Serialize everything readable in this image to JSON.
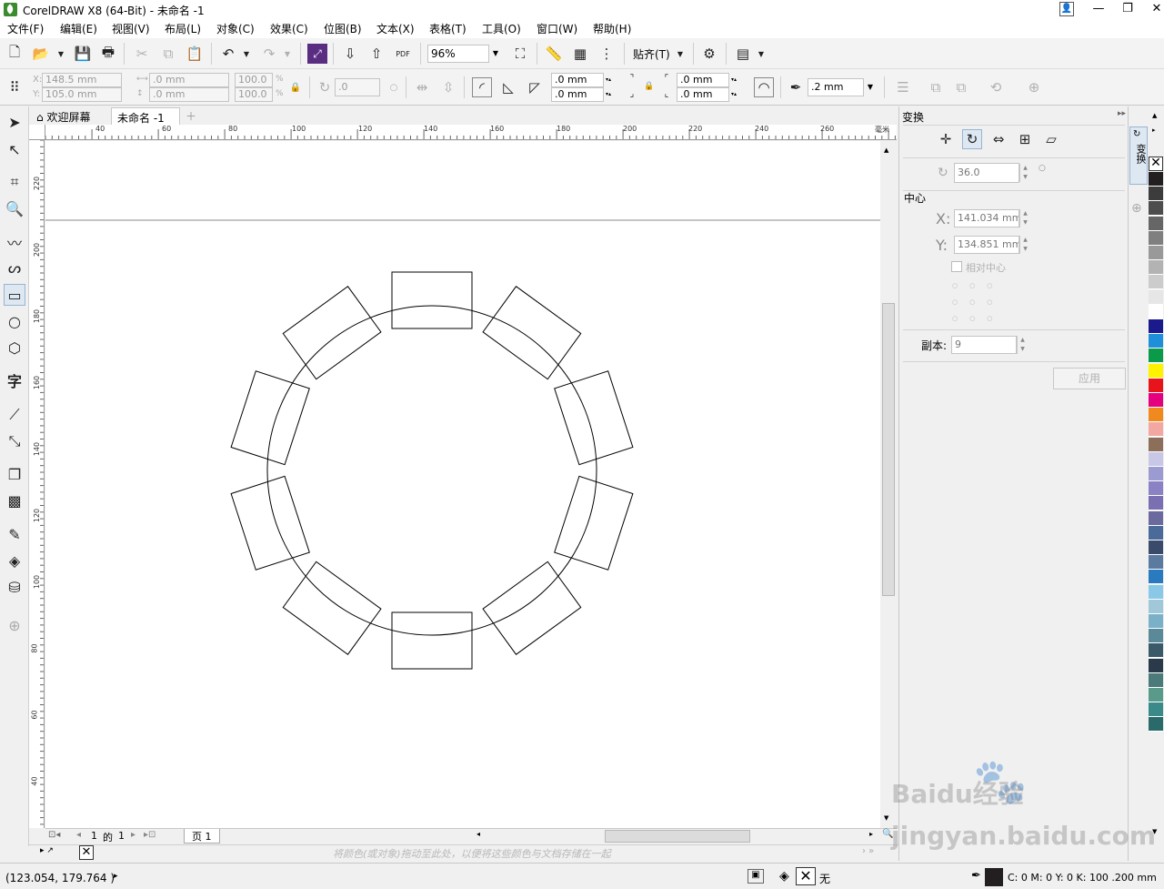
{
  "window": {
    "title": "CorelDRAW X8 (64-Bit) - 未命名 -1"
  },
  "menu": [
    "文件(F)",
    "编辑(E)",
    "视图(V)",
    "布局(L)",
    "对象(C)",
    "效果(C)",
    "位图(B)",
    "文本(X)",
    "表格(T)",
    "工具(O)",
    "窗口(W)",
    "帮助(H)"
  ],
  "toolbar": {
    "zoom_value": "96%",
    "snap_label": "贴齐(T)",
    "pdf_label": "PDF"
  },
  "property_bar": {
    "x": "148.5 mm",
    "y": "105.0 mm",
    "width": ".0 mm",
    "height": ".0 mm",
    "scale_x": "100.0",
    "scale_y": "100.0",
    "percent": "%",
    "rotation": ".0",
    "corner_1": ".0 mm",
    "corner_2": ".0 mm",
    "corner_3": ".0 mm",
    "corner_4": ".0 mm",
    "outline_width": ".2 mm"
  },
  "doc_tabs": {
    "welcome": "欢迎屏幕",
    "document": "未命名 -1"
  },
  "rulers": {
    "h_ticks": [
      "40",
      "60",
      "80",
      "100",
      "120",
      "140",
      "160",
      "180",
      "200",
      "220",
      "240",
      "260"
    ],
    "h_unit": "毫米",
    "v_ticks": [
      "220",
      "200",
      "180",
      "160",
      "140",
      "120",
      "100",
      "80",
      "60",
      "40"
    ]
  },
  "page_nav": {
    "current": "1",
    "of_label": "的",
    "total": "1",
    "page_tab": "页 1"
  },
  "color_hint": "将颜色(或对象)拖动至此处，以便将这些颜色与文档存储在一起",
  "docker": {
    "title": "变换",
    "angle": "36.0",
    "center_label": "中心",
    "x_label": "X:",
    "x_value": "141.034 mm",
    "y_label": "Y:",
    "y_value": "134.851 mm",
    "relative_center": "相对中心",
    "copies_label": "副本:",
    "copies_value": "9",
    "apply_label": "应用",
    "side_tab": "变换"
  },
  "palette": [
    "#231f20",
    "#3c3c3c",
    "#4d4d4d",
    "#666666",
    "#7f7f7f",
    "#999999",
    "#b3b3b3",
    "#cccccc",
    "#e6e6e6",
    "#ffffff",
    "#1a1a8c",
    "#1e8fd8",
    "#0a9a4a",
    "#fff200",
    "#e8141c",
    "#e4007f",
    "#f08a1e",
    "#f2a7a0",
    "#8c6e5a",
    "#c8c8e6",
    "#9b9bd2",
    "#8a82c4",
    "#7a6fb0",
    "#6a6a9e",
    "#4a6a9a",
    "#3a4a6a",
    "#5a7aa0",
    "#2a7ac0",
    "#8ac8e8",
    "#a0c8d8",
    "#7ab0c8",
    "#5a8a9a",
    "#3a5a6a",
    "#2a3a4a",
    "#4a7a7a",
    "#5a9a8a",
    "#3a8a8a",
    "#2a6a6a"
  ],
  "status": {
    "coords": "(123.054, 179.764 )",
    "fill_label": "无",
    "outline_info": "C: 0 M: 0 Y: 0 K: 100  .200 mm"
  },
  "watermark": "Baidu经验 jingyan.baidu.com"
}
